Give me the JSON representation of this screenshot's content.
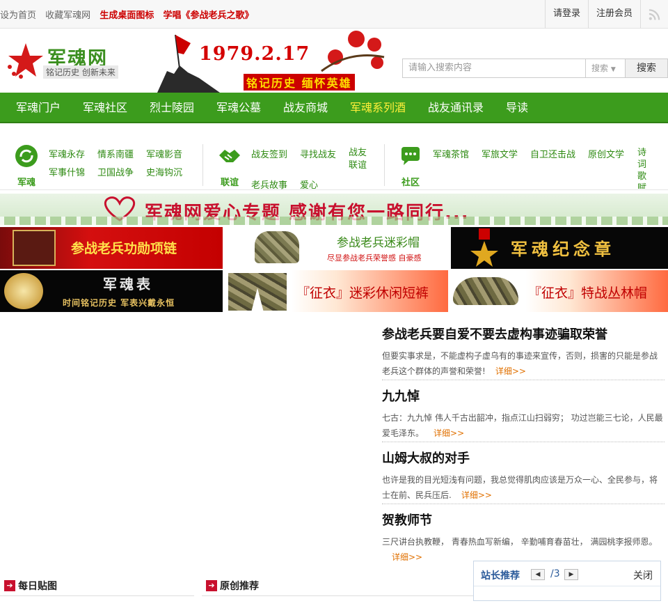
{
  "topbar": {
    "set_home": "设为首页",
    "favorite": "收藏军魂网",
    "desktop_icon": "生成桌面图标",
    "sing_song": "学唱《参战老兵之歌》",
    "login": "请登录",
    "register": "注册会员",
    "rss_icon": "rss-icon"
  },
  "header": {
    "logo_name": "军魂网",
    "logo_slogan": "铭记历史 创新未来",
    "banner_date": "1979.2.17",
    "banner_sub": "铭记历史 缅怀英雄"
  },
  "search": {
    "placeholder": "请输入搜索内容",
    "select": "搜索",
    "button": "搜索"
  },
  "nav": [
    "军魂门户",
    "军魂社区",
    "烈士陵园",
    "军魂公墓",
    "战友商城",
    "军魂系列酒",
    "战友通讯录",
    "导读"
  ],
  "subnav": {
    "g1": {
      "label": "军魂",
      "links": [
        "军魂永存",
        "情系南疆",
        "军魂影音",
        "军事什锦",
        "卫国战争",
        "史海钩沉"
      ]
    },
    "g2": {
      "label": "联谊",
      "links": [
        "战友签到",
        "寻找战友",
        "战友联谊",
        "老兵故事",
        "爱心"
      ]
    },
    "g3": {
      "label": "社区",
      "links": [
        "军魂茶馆",
        "军旅文学",
        "自卫还击战",
        "原创文学",
        "诗词歌赋"
      ]
    }
  },
  "love_banner": {
    "text": "军魂网爱心专题 感谢有您一路同行..."
  },
  "ads": [
    {
      "text": "参战老兵功勋项链"
    },
    {
      "text": "参战老兵迷彩帽",
      "sub": "尽显参战老兵荣誉感 自豪感"
    },
    {
      "text": "军魂纪念章"
    },
    {
      "text": "军魂表",
      "sub": "时间铭记历史 军表兴戴永恒"
    },
    {
      "text": "『征衣』迷彩休闲短裤"
    },
    {
      "text": "『征衣』特战丛林帽"
    }
  ],
  "articles": [
    {
      "title": "参战老兵要自爱不要去虚构事迹骗取荣誉",
      "body": "但要实事求是，不能虚构子虚乌有的事迹来宣传，否则，损害的只能是参战老兵这个群体的声誉和荣誉!",
      "more": "详细>>"
    },
    {
      "title": "九九悼",
      "body": "七古：九九悼 伟人千古出韶冲，指点江山扫弱穷； 功过岂能三七论，人民最爱毛泽东。",
      "more": "详细>>"
    },
    {
      "title": "山姆大叔的对手",
      "body": "也许是我的目光短浅有问题，我总觉得肌肉应该是万众一心、全民参与，将士在前、民兵压后.",
      "more": "详细>>"
    },
    {
      "title": "贺教师节",
      "body": "三尺讲台执教鞭， 青春热血写新编， 辛勤哺育春苗壮， 满园桃李报师恩。",
      "more": "详细>>"
    }
  ],
  "sections": {
    "daily_pic": "每日贴图",
    "original": "原创推荐"
  },
  "float_box": {
    "title": "站长推荐",
    "page": "/3",
    "close": "关闭"
  },
  "colors": {
    "nav_green": "#3c9c1d",
    "accent_red": "#c8102e",
    "highlight_yellow": "#ffef3a",
    "link_green": "#2e8a12"
  }
}
